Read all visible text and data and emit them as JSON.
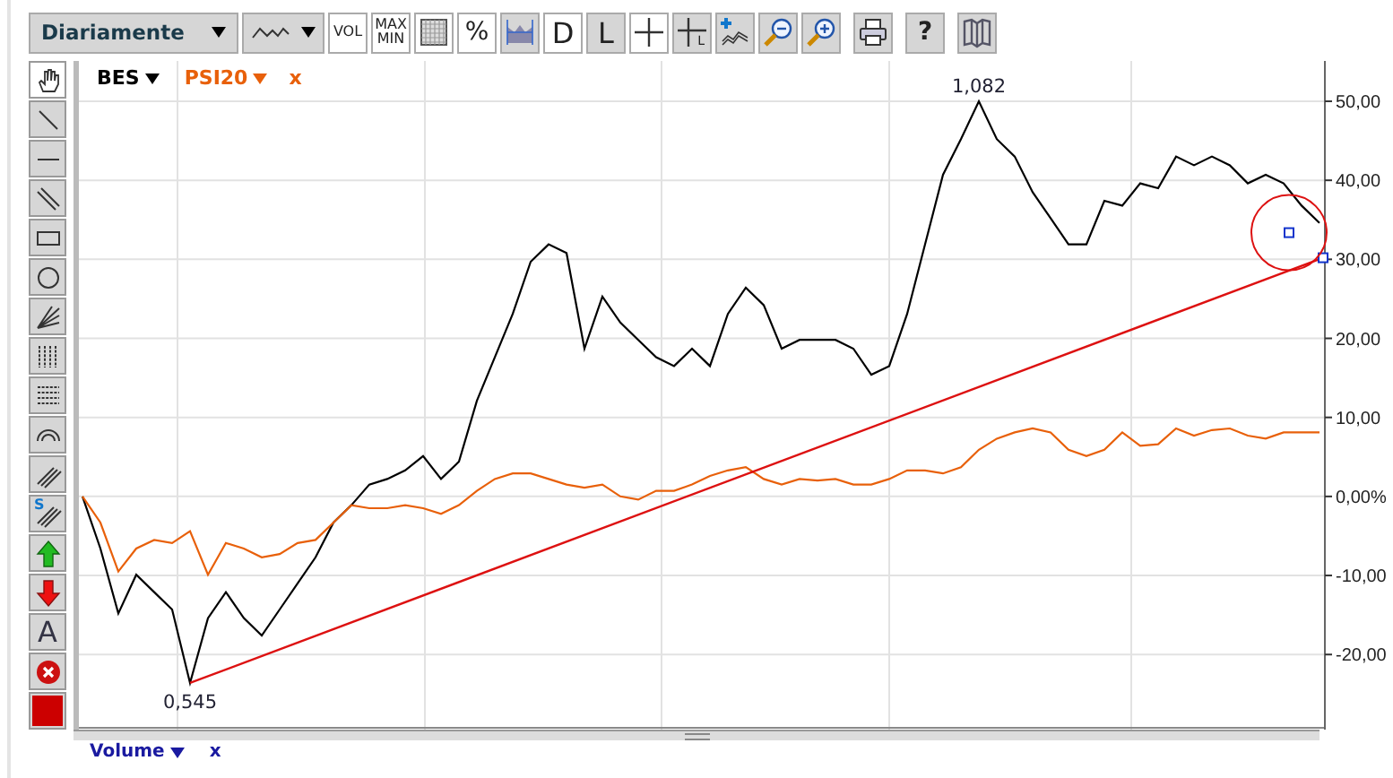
{
  "toolbar": {
    "period": {
      "label": "Diariamente"
    },
    "buttons": [
      {
        "kind": "vol",
        "label": "VOL",
        "selected": false
      },
      {
        "kind": "maxmin",
        "label": "MAX",
        "label2": "MIN",
        "selected": false
      },
      {
        "kind": "grid",
        "selected": false
      },
      {
        "kind": "percent",
        "label": "%",
        "selected": false
      },
      {
        "kind": "area",
        "selected": true
      },
      {
        "kind": "letter",
        "label": "D",
        "selected": false
      },
      {
        "kind": "letter",
        "label": "L",
        "selected": true
      },
      {
        "kind": "cross",
        "selected": false
      },
      {
        "kind": "crossl",
        "label": "L",
        "selected": true
      }
    ],
    "actions": [
      {
        "kind": "addseries"
      },
      {
        "kind": "zoomout"
      },
      {
        "kind": "zoomin"
      }
    ],
    "utilities": [
      {
        "kind": "print"
      },
      {
        "kind": "help",
        "label": "?"
      },
      {
        "kind": "book"
      }
    ]
  },
  "tools": [
    {
      "kind": "hand",
      "selected": true
    },
    {
      "kind": "line",
      "selected": false
    },
    {
      "kind": "hline",
      "selected": false
    },
    {
      "kind": "parallel",
      "selected": false
    },
    {
      "kind": "rect",
      "selected": false
    },
    {
      "kind": "circle",
      "selected": false
    },
    {
      "kind": "fan",
      "selected": false
    },
    {
      "kind": "vlines",
      "selected": false
    },
    {
      "kind": "hlines",
      "selected": false
    },
    {
      "kind": "arc",
      "selected": false
    },
    {
      "kind": "channel",
      "selected": false
    },
    {
      "kind": "schannel",
      "label": "S",
      "selected": false
    },
    {
      "kind": "up",
      "selected": false
    },
    {
      "kind": "down",
      "selected": false
    },
    {
      "kind": "text",
      "label": "A",
      "selected": false
    },
    {
      "kind": "delete",
      "selected": false
    },
    {
      "kind": "swatch",
      "color": "#cc0000",
      "selected": false
    }
  ],
  "chart": {
    "legend_close": "x",
    "drawings": [
      {
        "kind": "trendline"
      },
      {
        "kind": "circle"
      }
    ],
    "chart_data": {
      "type": "line",
      "ylim": [
        -29.5,
        55.1
      ],
      "grid": true,
      "legend": true,
      "yticks": [
        {
          "value": 50,
          "label": "50,00"
        },
        {
          "value": 40,
          "label": "40,00"
        },
        {
          "value": 30,
          "label": "30,00"
        },
        {
          "value": 20,
          "label": "20,00"
        },
        {
          "value": 10,
          "label": "10,00"
        },
        {
          "value": 0,
          "label": "0,00%"
        },
        {
          "value": -10,
          "label": "-10,00"
        },
        {
          "value": -20,
          "label": "-20,00"
        }
      ],
      "series": [
        {
          "name": "BES",
          "color": "#000000",
          "values": [
            0,
            -6.6,
            -14.8,
            -9.9,
            -12.1,
            -14.3,
            -23.6,
            -15.4,
            -12.1,
            -15.4,
            -17.6,
            -14.3,
            -11,
            -7.7,
            -3.3,
            -1.1,
            1.5,
            2.2,
            3.3,
            5.1,
            2.2,
            4.4,
            12.1,
            17.6,
            23.1,
            29.7,
            31.9,
            30.8,
            18.7,
            25.3,
            22,
            19.8,
            17.6,
            16.5,
            18.7,
            16.5,
            23.1,
            26.4,
            24.2,
            18.7,
            19.8,
            19.8,
            19.8,
            18.7,
            15.4,
            16.5,
            23.1,
            31.9,
            40.7,
            45.2,
            50,
            45.2,
            43,
            38.5,
            35.2,
            31.9,
            31.9,
            37.4,
            36.8,
            39.6,
            39,
            43,
            41.9,
            43,
            41.9,
            39.6,
            40.7,
            39.6,
            36.8,
            34.6
          ]
        },
        {
          "name": "PSI20",
          "color": "#e8600a",
          "values": [
            0,
            -3.3,
            -9.5,
            -6.6,
            -5.5,
            -5.9,
            -4.4,
            -9.9,
            -5.9,
            -6.6,
            -7.7,
            -7.3,
            -5.9,
            -5.5,
            -3.3,
            -1.1,
            -1.5,
            -1.5,
            -1.1,
            -1.5,
            -2.2,
            -1.1,
            0.7,
            2.2,
            2.9,
            2.9,
            2.2,
            1.5,
            1.1,
            1.5,
            0,
            -0.4,
            0.7,
            0.7,
            1.5,
            2.6,
            3.3,
            3.7,
            2.2,
            1.5,
            2.2,
            2,
            2.2,
            1.5,
            1.5,
            2.2,
            3.3,
            3.3,
            2.9,
            3.7,
            5.9,
            7.3,
            8.1,
            8.6,
            8.1,
            5.9,
            5.1,
            5.9,
            8.1,
            6.4,
            6.6,
            8.6,
            7.7,
            8.4,
            8.6,
            7.7,
            7.3,
            8.1,
            8.1,
            8.1
          ]
        }
      ],
      "annotations": [
        {
          "text": "1,082",
          "y": 50
        },
        {
          "text": "0,545",
          "y": -23.6
        }
      ]
    }
  },
  "volume": {
    "label": "Volume",
    "remove": "x"
  }
}
